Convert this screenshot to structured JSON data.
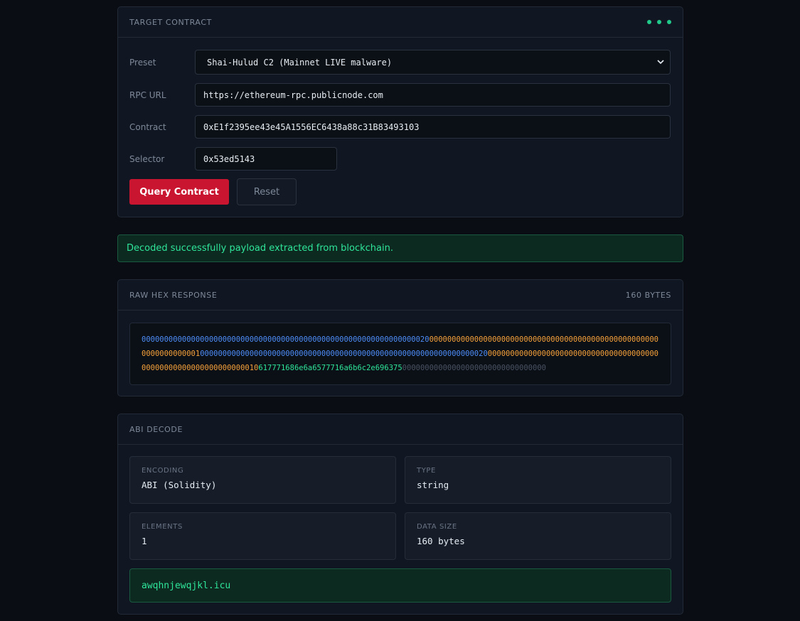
{
  "target": {
    "title": "TARGET CONTRACT",
    "accent": "#21c98a",
    "preset_label": "Preset",
    "preset_value": "Shai-Hulud C2 (Mainnet LIVE malware)",
    "rpc_label": "RPC URL",
    "rpc_value": "https://ethereum-rpc.publicnode.com",
    "contract_label": "Contract",
    "contract_value": "0xE1f2395ee43e45A1556EC6438a88c31B83493103",
    "selector_label": "Selector",
    "selector_value": "0x53ed5143",
    "query_label": "Query Contract",
    "reset_label": "Reset",
    "primary_color": "#c9152f"
  },
  "status": {
    "message": "Decoded successfully payload extracted from blockchain."
  },
  "raw_hex": {
    "title": "RAW HEX RESPONSE",
    "size_label": "160 BYTES",
    "segments": [
      {
        "color": "blue",
        "text": "0000000000000000000000000000000000000000000000000000000000000020"
      },
      {
        "color": "orange",
        "text": "0000000000000000000000000000000000000000000000000000000000000001"
      },
      {
        "color": "blue",
        "text": "0000000000000000000000000000000000000000000000000000000000000020"
      },
      {
        "color": "orange",
        "text": "0000000000000000000000000000000000000000000000000000000000000010"
      },
      {
        "color": "green",
        "text": "617771686e6a6577716a6b6c2e696375"
      },
      {
        "color": "gray",
        "text": "00000000000000000000000000000000"
      }
    ]
  },
  "abi": {
    "title": "ABI DECODE",
    "encoding_label": "ENCODING",
    "encoding_value": "ABI (Solidity)",
    "type_label": "TYPE",
    "type_value": "string",
    "elements_label": "ELEMENTS",
    "elements_value": "1",
    "size_label": "DATA SIZE",
    "size_value": "160 bytes",
    "decoded_value": "awqhnjewqjkl.icu"
  }
}
